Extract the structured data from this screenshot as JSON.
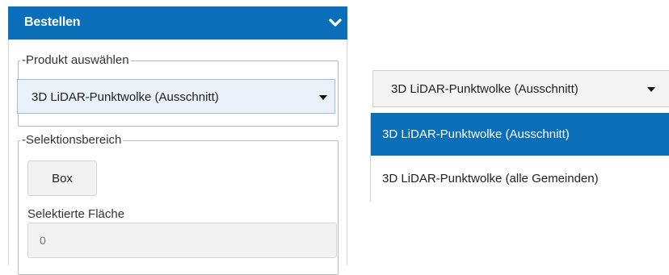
{
  "panel": {
    "title": "Bestellen",
    "collapse_icon": "chevron-down-icon",
    "accent_color": "#0a6fb8"
  },
  "product_group": {
    "legend": "-Produkt auswählen",
    "selected": "3D LiDAR-Punktwolke (Ausschnitt)",
    "dropdown_icon": "caret-down-icon"
  },
  "selection_group": {
    "legend": "-Selektionsbereich",
    "box_button": "Box",
    "area_label": "Selektierte Fläche",
    "area_value": "0"
  },
  "dropdown": {
    "selected": "3D LiDAR-Punktwolke (Ausschnitt)",
    "dropdown_icon": "caret-down-icon",
    "options": [
      {
        "label": "3D LiDAR-Punktwolke (Ausschnitt)",
        "selected": true
      },
      {
        "label": "3D LiDAR-Punktwolke (alle Gemeinden)",
        "selected": false
      }
    ],
    "highlight_color": "#0a6fb8"
  }
}
